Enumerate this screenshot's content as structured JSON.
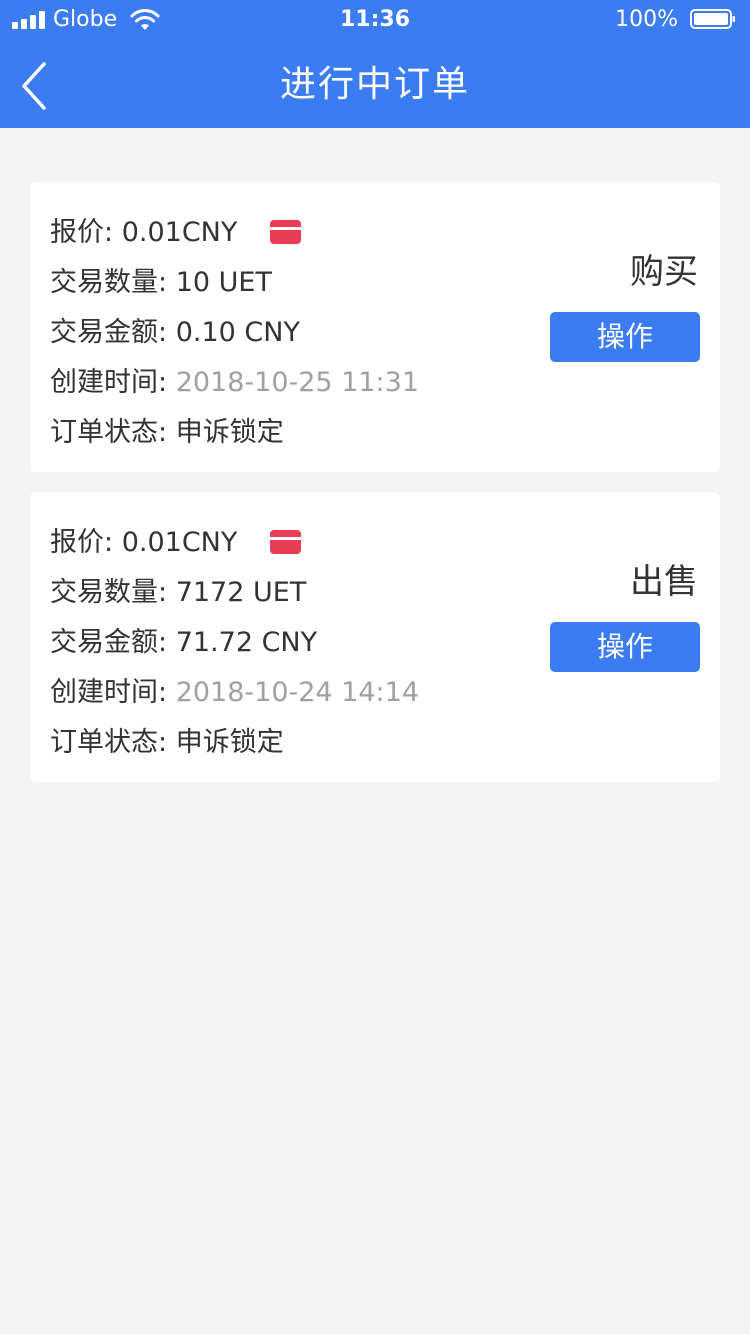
{
  "status_bar": {
    "carrier": "Globe",
    "time": "11:36",
    "battery": "100%"
  },
  "header": {
    "title": "进行中订单",
    "background_color": "#3b7cf3"
  },
  "orders": [
    {
      "price_label": "报价:",
      "price": "0.01CNY",
      "quantity_label": "交易数量:",
      "quantity": "10 UET",
      "amount_label": "交易金额:",
      "amount": "0.10 CNY",
      "created_label": "创建时间:",
      "created": "2018-10-25 11:31",
      "status_label": "订单状态:",
      "status": "申诉锁定",
      "type": "购买",
      "action_label": "操作",
      "payment_icon": "red-card-icon"
    },
    {
      "price_label": "报价:",
      "price": "0.01CNY",
      "quantity_label": "交易数量:",
      "quantity": "7172 UET",
      "amount_label": "交易金额:",
      "amount": "71.72 CNY",
      "created_label": "创建时间:",
      "created": "2018-10-24 14:14",
      "status_label": "订单状态:",
      "status": "申诉锁定",
      "type": "出售",
      "action_label": "操作",
      "payment_icon": "red-card-icon"
    }
  ]
}
